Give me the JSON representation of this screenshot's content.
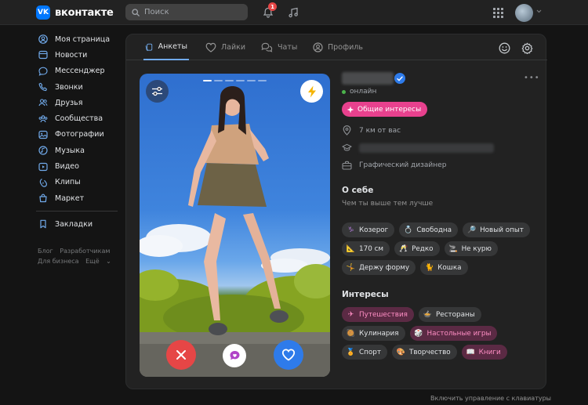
{
  "header": {
    "logo_text": "вконтакте",
    "logo_mark": "VK",
    "search_placeholder": "Поиск",
    "notification_count": "1",
    "icons": [
      "bell-icon",
      "music-icon",
      "apps-grid-icon"
    ]
  },
  "sidebar": {
    "items": [
      {
        "label": "Моя страница",
        "icon": "profile-icon"
      },
      {
        "label": "Новости",
        "icon": "news-icon"
      },
      {
        "label": "Мессенджер",
        "icon": "message-icon"
      },
      {
        "label": "Звонки",
        "icon": "phone-icon"
      },
      {
        "label": "Друзья",
        "icon": "friends-icon"
      },
      {
        "label": "Сообщества",
        "icon": "communities-icon"
      },
      {
        "label": "Фотографии",
        "icon": "photo-icon"
      },
      {
        "label": "Музыка",
        "icon": "music-icon"
      },
      {
        "label": "Видео",
        "icon": "video-icon"
      },
      {
        "label": "Клипы",
        "icon": "clips-icon"
      },
      {
        "label": "Маркет",
        "icon": "market-icon"
      }
    ],
    "bookmarks": {
      "label": "Закладки",
      "icon": "bookmark-icon"
    },
    "footer": {
      "blog": "Блог",
      "developers": "Разработчикам",
      "business": "Для бизнеса",
      "more": "Ещё"
    }
  },
  "tabs": [
    {
      "label": "Анкеты",
      "icon": "cards-icon",
      "active": true
    },
    {
      "label": "Лайки",
      "icon": "heart-icon",
      "active": false
    },
    {
      "label": "Чаты",
      "icon": "chats-icon",
      "active": false
    },
    {
      "label": "Профиль",
      "icon": "profile-icon",
      "active": false
    }
  ],
  "photo": {
    "photo_count": 6,
    "current_photo": 1
  },
  "profile": {
    "status": "онлайн",
    "common_interests_label": "Общие интересы",
    "distance": "7 км от вас",
    "job": "Графический дизайнер",
    "about_title": "О себе",
    "about_text": "Чем ты выше тем лучше",
    "traits": [
      {
        "label": "Козерог",
        "icon": "capricorn-icon",
        "glyph": "♑"
      },
      {
        "label": "Свободна",
        "icon": "ring-icon",
        "glyph": "💍"
      },
      {
        "label": "Новый опыт",
        "icon": "magnifier-icon",
        "glyph": "🔎"
      },
      {
        "label": "170 см",
        "icon": "ruler-icon",
        "glyph": "📐"
      },
      {
        "label": "Редко",
        "icon": "glasses-icon",
        "glyph": "🥂"
      },
      {
        "label": "Не курю",
        "icon": "cigarette-icon",
        "glyph": "🚬"
      },
      {
        "label": "Держу форму",
        "icon": "runner-icon",
        "glyph": "🤸"
      },
      {
        "label": "Кошка",
        "icon": "cat-icon",
        "glyph": "🐈"
      }
    ],
    "interests_title": "Интересы",
    "interests": [
      {
        "label": "Путешествия",
        "icon": "plane-icon",
        "glyph": "✈",
        "common": true
      },
      {
        "label": "Рестораны",
        "icon": "dish-icon",
        "glyph": "🍲",
        "common": false
      },
      {
        "label": "Кулинария",
        "icon": "cooking-icon",
        "glyph": "🥘",
        "common": false
      },
      {
        "label": "Настольные игры",
        "icon": "dice-icon",
        "glyph": "🎲",
        "common": true
      },
      {
        "label": "Спорт",
        "icon": "medal-icon",
        "glyph": "🏅",
        "common": false
      },
      {
        "label": "Творчество",
        "icon": "palette-icon",
        "glyph": "🎨",
        "common": false
      },
      {
        "label": "Книги",
        "icon": "book-icon",
        "glyph": "📖",
        "common": true
      }
    ]
  },
  "footer_hint": "Включить управление с клавиатуры",
  "colors": {
    "accent_blue": "#71aaeb",
    "pink": "#e8418e",
    "dislike_red": "#e64646",
    "like_blue": "#2e7bea"
  }
}
